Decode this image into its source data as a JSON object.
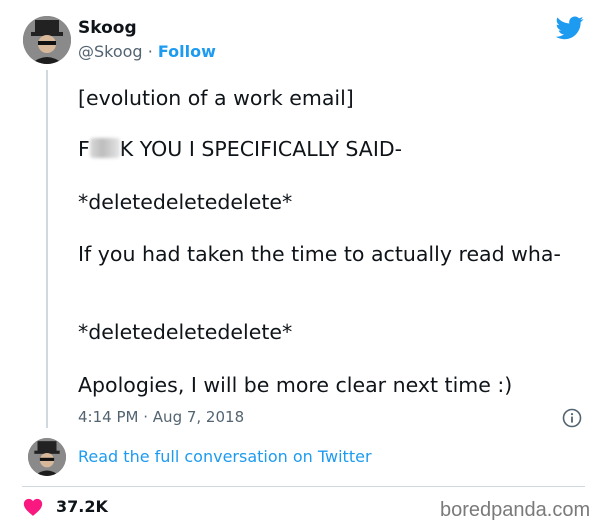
{
  "header": {
    "display_name": "Skoog",
    "handle": "@Skoog",
    "separator": "·",
    "follow_label": "Follow"
  },
  "tweet": {
    "lines": [
      "[evolution of a work email]",
      "K YOU I SPECIFICALLY SAID-",
      "*deletedeletedelete*",
      "If you had taken the time to actually read wha-",
      "*deletedeletedelete*",
      "Apologies, I will be more clear next time :)"
    ],
    "line2_prefix": "F",
    "time": "4:14 PM",
    "date": "Aug 7, 2018",
    "meta_separator": "·"
  },
  "footer": {
    "read_link": "Read the full conversation on Twitter",
    "like_count": "37.2K",
    "watermark": "boredpanda.com"
  },
  "colors": {
    "accent": "#1d9bf0",
    "heart": "#f91880",
    "muted": "#536471"
  },
  "icons": {
    "brand": "twitter-bird-icon",
    "info": "info-icon",
    "like": "heart-icon"
  }
}
